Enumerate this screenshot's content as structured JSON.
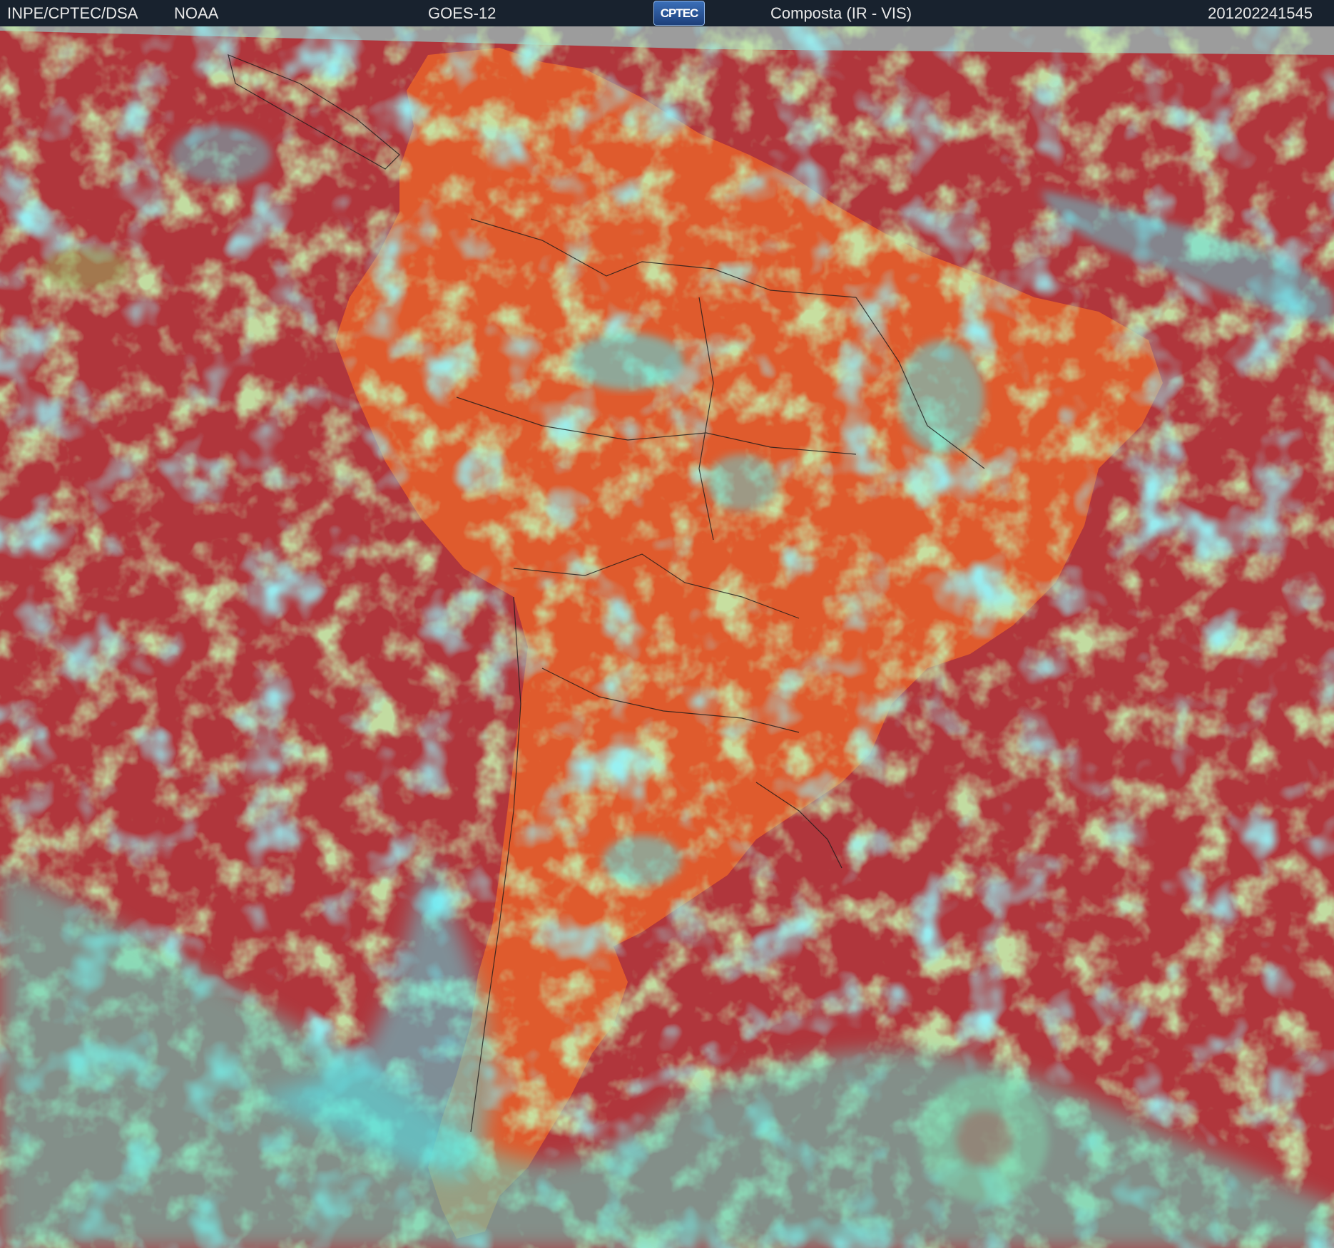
{
  "header": {
    "organization": "INPE/CPTEC/DSA",
    "agency": "NOAA",
    "satellite": "GOES-12",
    "logo_text": "CPTEC",
    "product": "Composta (IR - VIS)",
    "timestamp": "201202241545"
  },
  "colors": {
    "ocean_clear": "#b0363c",
    "land_clear": "#e8622a",
    "low_cloud": "#8fdc6a",
    "high_cloud": "#4fe6f0",
    "mid_cloud": "#5a78c8",
    "no_data": "#9c9c9c",
    "borders": "#1a1a1a"
  },
  "legend_icons": [
    "satellite-composite-map",
    "cptec-logo"
  ]
}
